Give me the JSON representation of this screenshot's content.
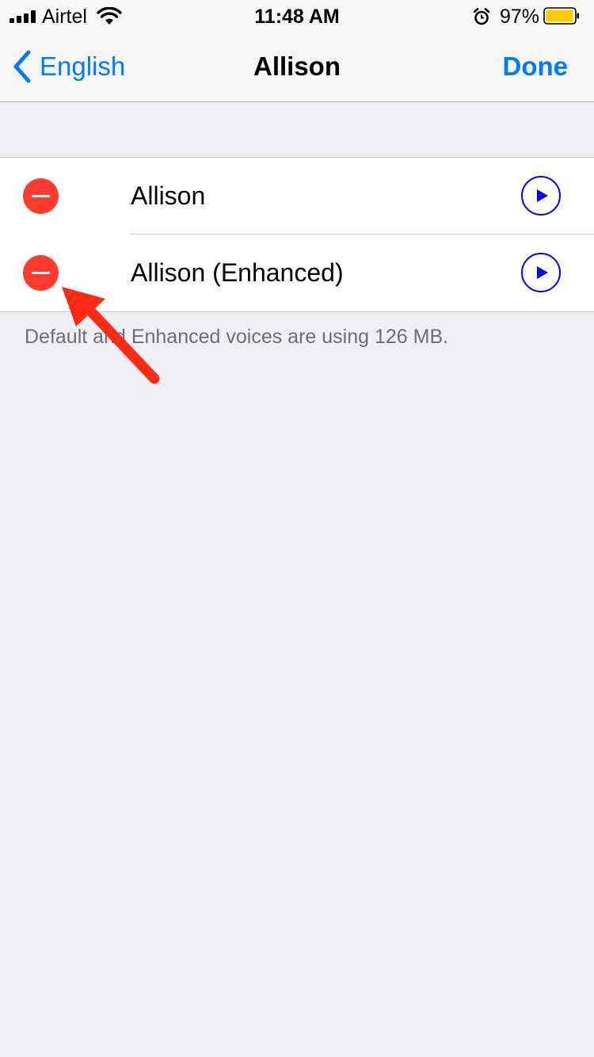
{
  "status_bar": {
    "carrier": "Airtel",
    "time": "11:48 AM",
    "battery_percent": "97%",
    "battery_level": 0.97,
    "battery_color": "#FFCC00",
    "icons": [
      "signal-icon",
      "wifi-icon",
      "alarm-icon",
      "battery-icon"
    ]
  },
  "nav": {
    "back_label": "English",
    "title": "Allison",
    "done_label": "Done"
  },
  "voices": [
    {
      "name": "Allison"
    },
    {
      "name": "Allison (Enhanced)"
    }
  ],
  "footer_note": "Default and Enhanced voices are using 126 MB.",
  "colors": {
    "accent": "#007AFF",
    "delete": "#FF3B30",
    "play": "#0000FF",
    "annotation": "#FF2A13"
  }
}
